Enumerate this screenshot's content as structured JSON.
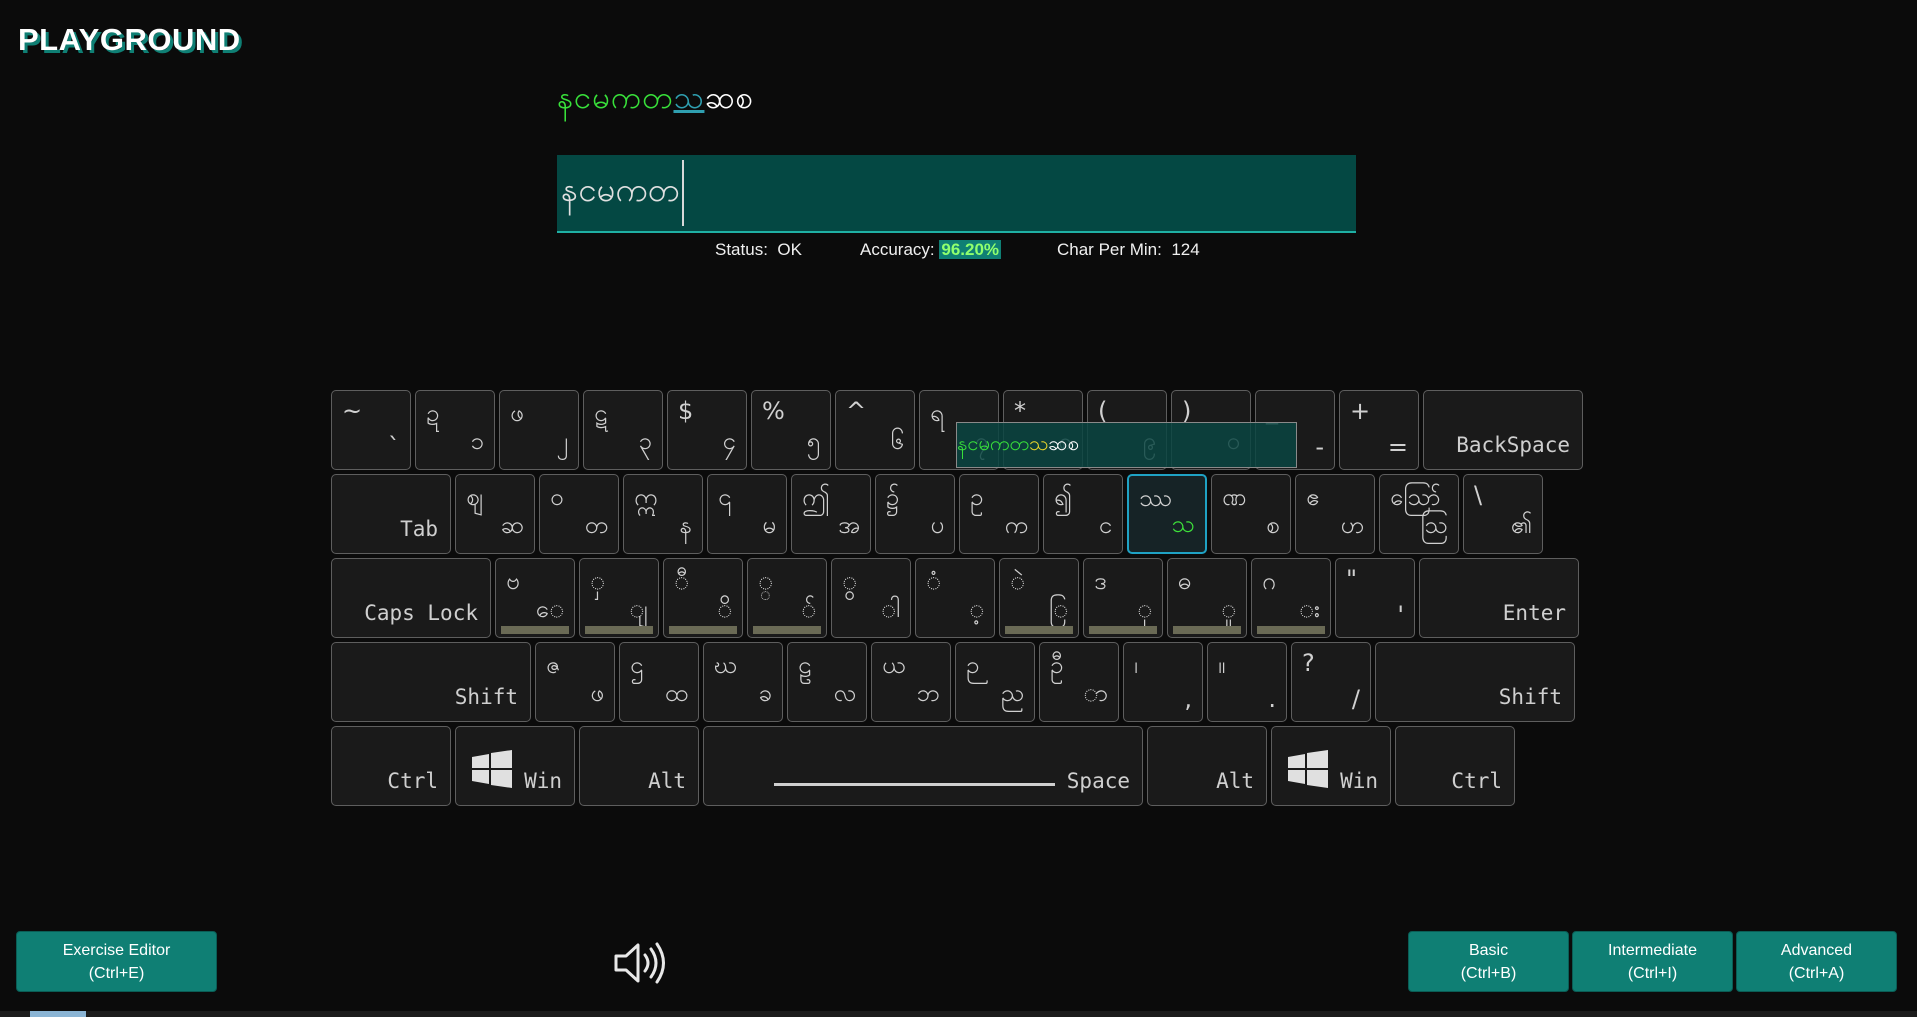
{
  "app": {
    "title": "PLAYGROUND"
  },
  "exercise": {
    "typed_text": "နငမကတ",
    "current_char": "သ",
    "remaining_text": "ဆစ",
    "input_value": "နငမကတ"
  },
  "status": {
    "status_label": "Status:",
    "status_value": "OK",
    "accuracy_label": "Accuracy:",
    "accuracy_value": "96.20%",
    "cpm_label": "Char Per Min:",
    "cpm_value": "124"
  },
  "popup": {
    "typed": "နငမကတ",
    "current": "သ",
    "remaining": "ဆစ"
  },
  "keyboard": {
    "row1": [
      {
        "top": "~",
        "bottom": "`"
      },
      {
        "top": "ဍ",
        "bottom": "၁"
      },
      {
        "top": "ဖ",
        "bottom": "၂"
      },
      {
        "top": "ဋ",
        "bottom": "၃"
      },
      {
        "top": "$",
        "bottom": "၄"
      },
      {
        "top": "%",
        "bottom": "၅"
      },
      {
        "top": "^",
        "bottom": "၆"
      },
      {
        "top": "ရ",
        "bottom": "၇"
      },
      {
        "top": "*",
        "bottom": "၈"
      },
      {
        "top": "(",
        "bottom": "၉"
      },
      {
        "top": ")",
        "bottom": "၀"
      },
      {
        "top": "_",
        "bottom": "-"
      },
      {
        "top": "+",
        "bottom": "="
      }
    ],
    "backspace": "BackSpace",
    "tab": "Tab",
    "row2": [
      {
        "top": "ဈ",
        "bottom": "ဆ"
      },
      {
        "top": "ဝ",
        "bottom": "တ"
      },
      {
        "top": "ဣ",
        "bottom": "န"
      },
      {
        "top": "၎",
        "bottom": "မ"
      },
      {
        "top": "ဤ",
        "bottom": "အ"
      },
      {
        "top": "၌",
        "bottom": "ပ"
      },
      {
        "top": "ဥ",
        "bottom": "က"
      },
      {
        "top": "၍",
        "bottom": "င"
      },
      {
        "top": "ဿ",
        "bottom": "သ"
      },
      {
        "top": "ဏ",
        "bottom": "စ"
      },
      {
        "top": "ဧ",
        "bottom": "ဟ"
      },
      {
        "top": "ဪ",
        "bottom": "ဩ"
      },
      {
        "top": "\\",
        "bottom": "၏"
      }
    ],
    "capslock": "Caps Lock",
    "row3": [
      {
        "top": "ဗ",
        "bottom": "ေ",
        "bar": true
      },
      {
        "top": "ှ",
        "bottom": "ျ",
        "bar": true
      },
      {
        "top": "ီ",
        "bottom": "ိ",
        "bar": true
      },
      {
        "top": "္",
        "bottom": "်",
        "bar": true
      },
      {
        "top": "ွ",
        "bottom": "ါ",
        "bar": false
      },
      {
        "top": "ံ",
        "bottom": "့",
        "bar": false
      },
      {
        "top": "ဲ",
        "bottom": "ြ",
        "bar": true
      },
      {
        "top": "ဒ",
        "bottom": "ု",
        "bar": true
      },
      {
        "top": "ဓ",
        "bottom": "ူ",
        "bar": true
      },
      {
        "top": "ဂ",
        "bottom": "း",
        "bar": true
      },
      {
        "top": "\"",
        "bottom": "'",
        "bar": false
      }
    ],
    "enter": "Enter",
    "shift_left": "Shift",
    "row4": [
      {
        "top": "ဇ",
        "bottom": "ဖ"
      },
      {
        "top": "ဌ",
        "bottom": "ထ"
      },
      {
        "top": "ဃ",
        "bottom": "ခ"
      },
      {
        "top": "ဠ",
        "bottom": "လ"
      },
      {
        "top": "ယ",
        "bottom": "ဘ"
      },
      {
        "top": "ဉ",
        "bottom": "ည"
      },
      {
        "top": "ဦ",
        "bottom": "ာ"
      },
      {
        "top": "၊",
        "bottom": ","
      },
      {
        "top": "။",
        "bottom": "."
      },
      {
        "top": "?",
        "bottom": "/"
      }
    ],
    "shift_right": "Shift",
    "ctrl_left": "Ctrl",
    "win_left": "Win",
    "alt_left": "Alt",
    "space": "Space",
    "alt_right": "Alt",
    "win_right": "Win",
    "ctrl_right": "Ctrl",
    "active_key": "သ"
  },
  "buttons": {
    "exercise_editor": {
      "line1": "Exercise Editor",
      "line2": "(Ctrl+E)"
    },
    "basic": {
      "line1": "Basic",
      "line2": "(Ctrl+B)"
    },
    "intermediate": {
      "line1": "Intermediate",
      "line2": "(Ctrl+I)"
    },
    "advanced": {
      "line1": "Advanced",
      "line2": "(Ctrl+A)"
    }
  },
  "icons": {
    "sound": "speaker-icon",
    "windows": "windows-logo-icon"
  },
  "colors": {
    "accent": "#0f7f74",
    "typed": "#38e03a",
    "current": "#2f9fb0",
    "input_bg": "#044843"
  }
}
